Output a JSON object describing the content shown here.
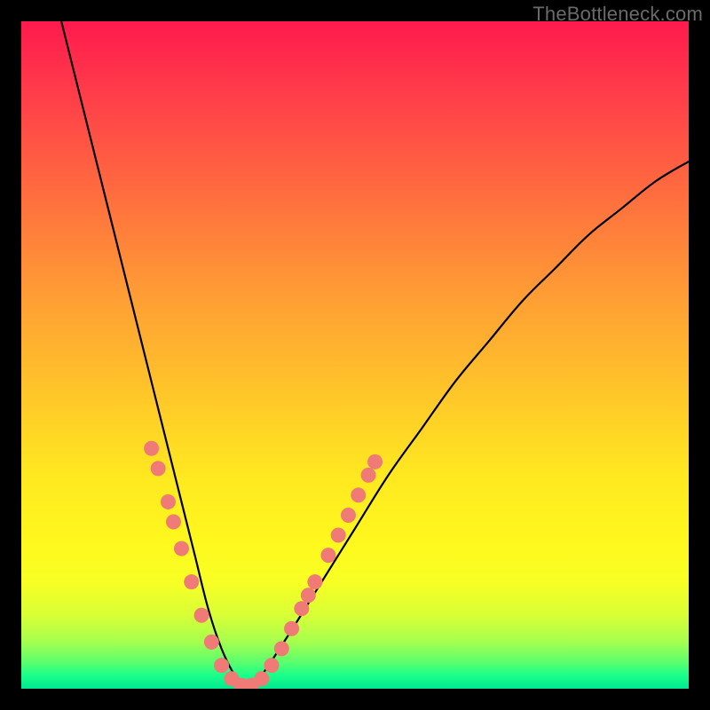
{
  "watermark": "TheBottleneck.com",
  "chart_data": {
    "type": "line",
    "title": "",
    "xlabel": "",
    "ylabel": "",
    "xlim": [
      0,
      100
    ],
    "ylim": [
      0,
      100
    ],
    "gradient_stops": [
      {
        "pos": 0,
        "color": "#ff1a4d"
      },
      {
        "pos": 10,
        "color": "#ff3a4a"
      },
      {
        "pos": 25,
        "color": "#ff6a3f"
      },
      {
        "pos": 40,
        "color": "#ff9a35"
      },
      {
        "pos": 55,
        "color": "#ffc42a"
      },
      {
        "pos": 68,
        "color": "#ffe820"
      },
      {
        "pos": 78,
        "color": "#fff81e"
      },
      {
        "pos": 84,
        "color": "#f8ff24"
      },
      {
        "pos": 89,
        "color": "#d8ff36"
      },
      {
        "pos": 93,
        "color": "#a5ff4e"
      },
      {
        "pos": 96,
        "color": "#5cff6e"
      },
      {
        "pos": 98,
        "color": "#1aff8a"
      },
      {
        "pos": 100,
        "color": "#00e98f"
      }
    ],
    "series": [
      {
        "name": "bottleneck-curve",
        "x": [
          6,
          8,
          10,
          12,
          14,
          16,
          18,
          20,
          22,
          24,
          26,
          28,
          30,
          32,
          34,
          36,
          40,
          45,
          50,
          55,
          60,
          65,
          70,
          75,
          80,
          85,
          90,
          95,
          100
        ],
        "y": [
          100,
          92,
          84,
          76,
          68,
          60,
          52,
          44,
          36,
          28,
          20,
          12,
          6,
          2,
          0,
          2,
          8,
          16,
          24,
          32,
          39,
          46,
          52,
          58,
          63,
          68,
          72,
          76,
          79
        ]
      }
    ],
    "markers": {
      "name": "highlight-dots",
      "color": "#ef7a76",
      "points": [
        {
          "x": 19.5,
          "y": 36
        },
        {
          "x": 20.5,
          "y": 33
        },
        {
          "x": 22.0,
          "y": 28
        },
        {
          "x": 22.8,
          "y": 25
        },
        {
          "x": 24.0,
          "y": 21
        },
        {
          "x": 25.5,
          "y": 16
        },
        {
          "x": 27.0,
          "y": 11
        },
        {
          "x": 28.5,
          "y": 7
        },
        {
          "x": 30.0,
          "y": 3.5
        },
        {
          "x": 31.5,
          "y": 1.5
        },
        {
          "x": 33.0,
          "y": 0.5
        },
        {
          "x": 34.5,
          "y": 0.5
        },
        {
          "x": 36.0,
          "y": 1.5
        },
        {
          "x": 37.5,
          "y": 3.5
        },
        {
          "x": 39.0,
          "y": 6
        },
        {
          "x": 40.5,
          "y": 9
        },
        {
          "x": 42.0,
          "y": 12
        },
        {
          "x": 43.0,
          "y": 14
        },
        {
          "x": 44.0,
          "y": 16
        },
        {
          "x": 46.0,
          "y": 20
        },
        {
          "x": 47.5,
          "y": 23
        },
        {
          "x": 49.0,
          "y": 26
        },
        {
          "x": 50.5,
          "y": 29
        },
        {
          "x": 52.0,
          "y": 32
        },
        {
          "x": 53.0,
          "y": 34
        }
      ]
    }
  }
}
